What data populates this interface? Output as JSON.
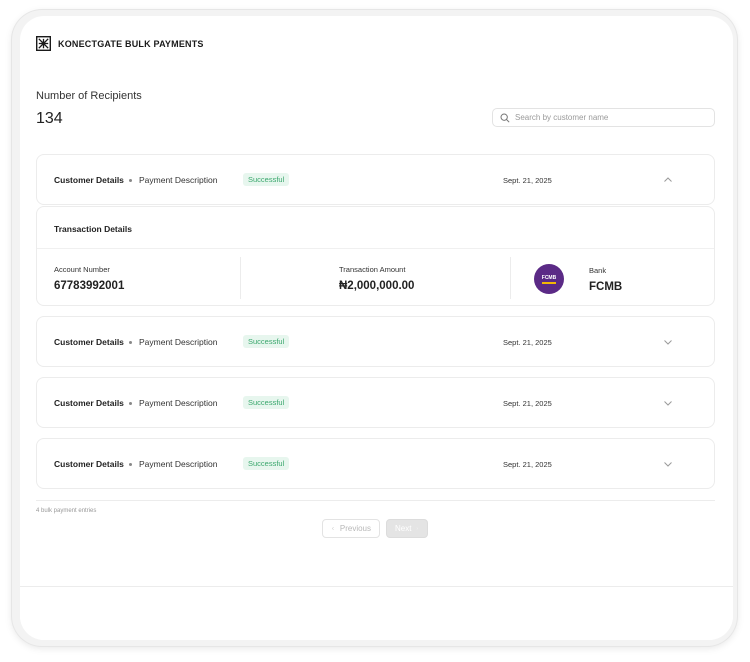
{
  "brand": {
    "name": "KONECTGATE BULK PAYMENTS",
    "icon": "konectgate-logo-icon"
  },
  "summary": {
    "recipients_label": "Number of Recipients",
    "recipients_count": "134"
  },
  "search": {
    "placeholder": "Search by customer name",
    "icon": "search-icon"
  },
  "rows": [
    {
      "customer": "Customer Details",
      "description": "Payment Description",
      "status": "Successful",
      "date": "Sept. 21, 2025",
      "expanded": true
    },
    {
      "customer": "Customer Details",
      "description": "Payment Description",
      "status": "Successful",
      "date": "Sept. 21, 2025",
      "expanded": false
    },
    {
      "customer": "Customer Details",
      "description": "Payment Description",
      "status": "Successful",
      "date": "Sept. 21, 2025",
      "expanded": false
    },
    {
      "customer": "Customer Details",
      "description": "Payment Description",
      "status": "Successful",
      "date": "Sept. 21, 2025",
      "expanded": false
    }
  ],
  "details": {
    "title": "Transaction Details",
    "account_label": "Account Number",
    "account_value": "67783992001",
    "amount_label": "Transaction Amount",
    "amount_value": "₦2,000,000.00",
    "bank_label": "Bank",
    "bank_value": "FCMB",
    "bank_logo_text": "FCMB"
  },
  "footer": {
    "entries": "4 bulk payment entries",
    "previous": "Previous",
    "next": "Next"
  },
  "colors": {
    "success_text": "#3aa76d",
    "success_bg": "#e7f6ee",
    "bank_purple": "#5b2a86",
    "bank_gold": "#f2b705"
  }
}
